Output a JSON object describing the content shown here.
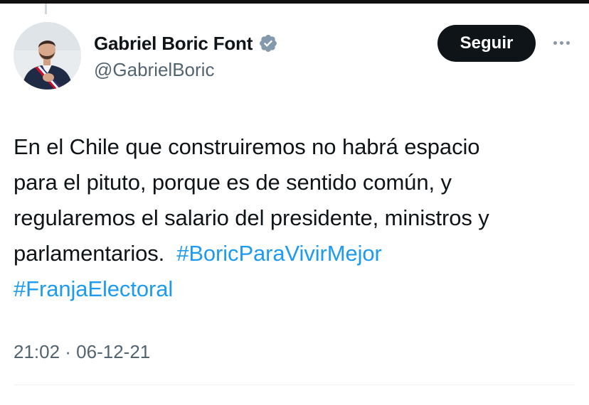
{
  "author": {
    "display_name": "Gabriel Boric Font",
    "handle": "@GabrielBoric",
    "verified": true,
    "avatar_icon": "profile-photo"
  },
  "actions": {
    "follow_label": "Seguir",
    "more_icon": "more-options-icon"
  },
  "tweet": {
    "lines": [
      "En el Chile que construiremos no habrá espacio",
      "para el pituto, porque es de sentido común, y",
      "regularemos el salario del presidente, ministros y",
      "parlamentarios."
    ],
    "hashtags": [
      "#BoricParaVivirMejor",
      "#FranjaElectoral"
    ],
    "timestamp": "21:02 · 06-12-21"
  },
  "colors": {
    "link": "#1d9bf0",
    "text": "#0f1419",
    "muted": "#536471",
    "verified_badge": "#829aab",
    "button_bg": "#0f1419"
  }
}
